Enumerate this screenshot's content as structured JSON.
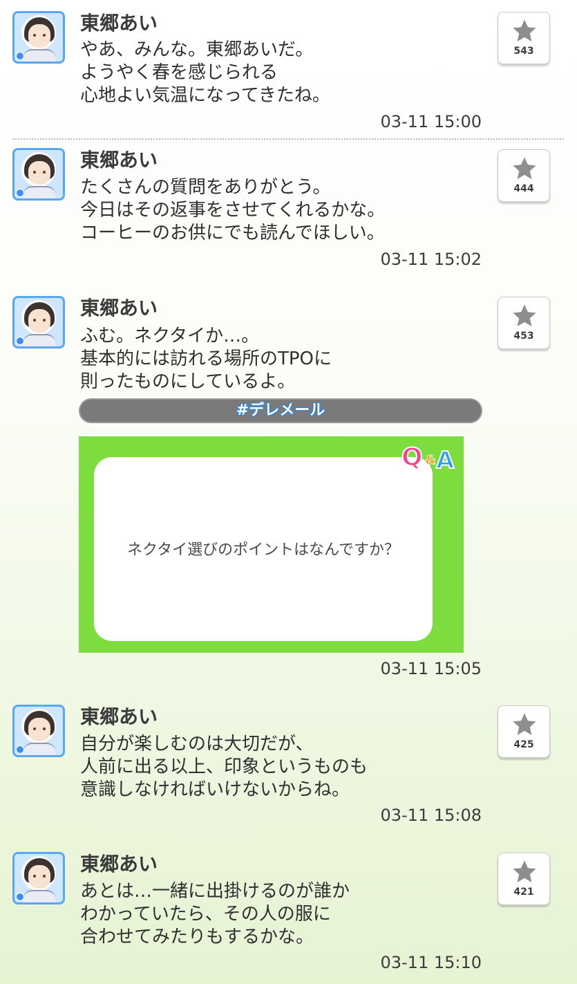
{
  "posts": [
    {
      "name": "東郷あい",
      "message": "やあ、みんな。東郷あいだ。\nようやく春を感じられる\n心地よい気温になってきたね。",
      "time": "03-11 15:00",
      "likes": "543"
    },
    {
      "name": "東郷あい",
      "message": "たくさんの質問をありがとう。\n今日はその返事をさせてくれるかな。\nコーヒーのお供にでも読んでほしい。",
      "time": "03-11 15:02",
      "likes": "444"
    },
    {
      "name": "東郷あい",
      "message": "ふむ。ネクタイか…。\n基本的には訪れる場所のTPOに\n則ったものにしているよ。",
      "time": "03-11 15:05",
      "likes": "453",
      "tag": "#デレメール",
      "qa_question": "ネクタイ選びのポイントはなんですか？",
      "qa_badge_q": "Q",
      "qa_badge_amp": "&",
      "qa_badge_a": "A"
    },
    {
      "name": "東郷あい",
      "message": "自分が楽しむのは大切だが、\n人前に出る以上、印象というものも\n意識しなければいけないからね。",
      "time": "03-11 15:08",
      "likes": "425"
    },
    {
      "name": "東郷あい",
      "message": "あとは…一緒に出掛けるのが誰か\nわかっていたら、その人の服に\n合わせてみたりもするかな。",
      "time": "03-11 15:10",
      "likes": "421"
    }
  ],
  "icons": {
    "like": "star-icon",
    "avatar_badge": "gem-icon"
  },
  "colors": {
    "avatar_border": "#5aa6f0",
    "qa_background": "#7ddc3e",
    "tag_bar": "#7a7a7a",
    "star": "#8e8e8e"
  }
}
